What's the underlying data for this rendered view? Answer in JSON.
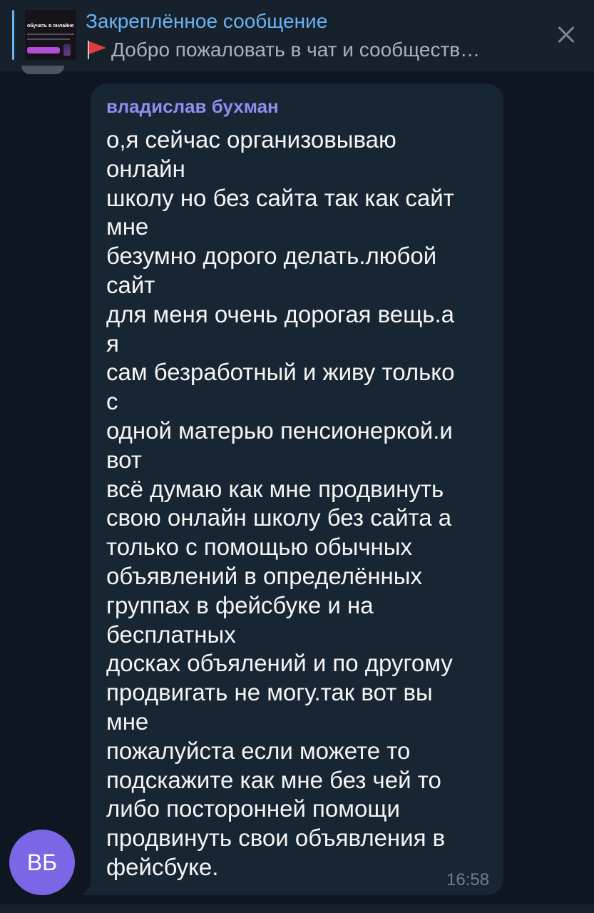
{
  "pinned": {
    "title": "Закреплённое сообщение",
    "text": "Добро пожаловать в чат и сообществ…",
    "flag_icon": "red-flag",
    "thumbnail_caption": "обучать в онлайне"
  },
  "message": {
    "sender": "владислав бухман",
    "text": "о,я сейчас организовываю\nонлайн\nшколу но без сайта так как сайт\nмне\nбезумно дорого делать.любой\nсайт\nдля меня очень дорогая вещь.а\nя\nсам безработный и живу только\nс\nодной матерью пенсионеркой.и\nвот\nвсё думаю как мне продвинуть\nсвою онлайн школу без сайта а\nтолько с помощью обычных\nобъявлений в определённых\nгруппах в фейсбуке и на\nбесплатных\nдосках объялений и по другому\nпродвигать не могу.так вот вы\nмне\nпожалуйста если можете то\nподскажите как мне без чей то\nлибо посторонней помощи\nпродвинуть свои объявления в\nфейсбуке.",
    "time": "16:58",
    "avatar_initials": "ВБ"
  },
  "colors": {
    "background": "#0e1621",
    "header": "#17212b",
    "bubble": "#182533",
    "accent": "#6ab2f2",
    "sender": "#8f8ef0",
    "avatar": "#7b66e6"
  }
}
